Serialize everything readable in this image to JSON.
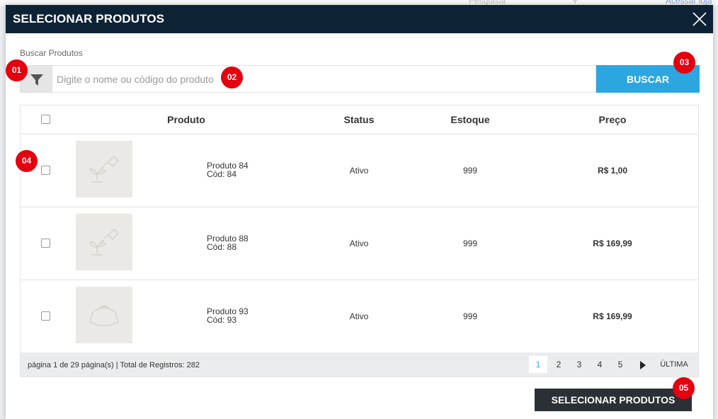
{
  "background": {
    "search_placeholder": "Pesquisar",
    "store_link": "Acessar loja"
  },
  "modal": {
    "title": "SELECIONAR PRODUTOS"
  },
  "search": {
    "label": "Buscar Produtos",
    "placeholder": "Digite o nome ou código do produto",
    "value": "",
    "button": "BUSCAR"
  },
  "table": {
    "headers": {
      "product": "Produto",
      "status": "Status",
      "stock": "Estoque",
      "price": "Preço"
    },
    "rows": [
      {
        "name": "Produto 84",
        "code": "Cód: 84",
        "status": "Ativo",
        "stock": "999",
        "price": "R$ 1,00",
        "thumb_icon": "plant-watering-icon"
      },
      {
        "name": "Produto 88",
        "code": "Cód: 88",
        "status": "Ativo",
        "stock": "999",
        "price": "R$ 169,99",
        "thumb_icon": "plant-watering-icon"
      },
      {
        "name": "Produto 93",
        "code": "Cód: 93",
        "status": "Ativo",
        "stock": "999",
        "price": "R$ 169,99",
        "thumb_icon": "purse-icon"
      }
    ]
  },
  "pagination": {
    "summary": "página 1 de 29 página(s) | Total de Registros: 282",
    "pages": [
      "1",
      "2",
      "3",
      "4",
      "5"
    ],
    "current": "1",
    "last": "ÚLTIMA"
  },
  "submit_button": "SELECIONAR PRODUTOS",
  "markers": [
    "01",
    "02",
    "03",
    "04",
    "05"
  ],
  "colors": {
    "header": "#0e2236",
    "accent": "#2ca6e0",
    "submit": "#2b2f36",
    "marker": "#e3000f"
  }
}
